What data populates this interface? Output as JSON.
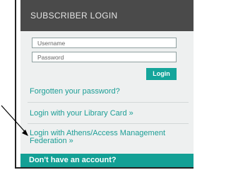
{
  "login_panel": {
    "title": "SUBSCRIBER LOGIN",
    "username_placeholder": "Username",
    "password_placeholder": "Password",
    "login_button": "Login",
    "forgot_password_link": "Forgotten your password?",
    "library_card_link": "Login with your Library Card »",
    "athens_link": "Login with Athens/Access Management Federation »",
    "no_account_text": "Don't have an account?"
  },
  "colors": {
    "header_bg": "#4a4a4a",
    "panel_bg": "#eef0f0",
    "accent": "#15a59b",
    "link": "#1c9e96"
  }
}
